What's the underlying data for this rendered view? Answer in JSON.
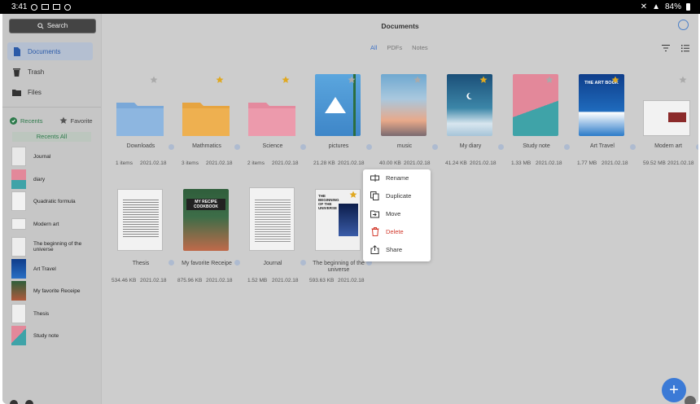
{
  "status": {
    "time": "3:41",
    "battery": "84%"
  },
  "sidebar": {
    "search_label": "Search",
    "nav": [
      {
        "label": "Documents"
      },
      {
        "label": "Trash"
      },
      {
        "label": "Files"
      }
    ],
    "recents_tab": "Recents",
    "favorite_tab": "Favorite",
    "recents_all": "Recents All",
    "recents": [
      {
        "label": "Journal"
      },
      {
        "label": "diary"
      },
      {
        "label": "Quadratic formula"
      },
      {
        "label": "Modern art"
      },
      {
        "label": "The beginning of the universe"
      },
      {
        "label": "Art Travel"
      },
      {
        "label": "My favorite Receipe"
      },
      {
        "label": "Thesis"
      },
      {
        "label": "Study note"
      }
    ]
  },
  "header": {
    "title": "Documents",
    "filters": [
      {
        "label": "All"
      },
      {
        "label": "PDFs"
      },
      {
        "label": "Notes"
      }
    ]
  },
  "grid": {
    "row1": [
      {
        "name": "Downloads",
        "size": "1 items",
        "date": "2021.02.18",
        "starred": false
      },
      {
        "name": "Mathmatics",
        "size": "3 items",
        "date": "2021.02.18",
        "starred": true
      },
      {
        "name": "Science",
        "size": "2 items",
        "date": "2021.02.18",
        "starred": true
      },
      {
        "name": "pictures",
        "size": "21.28 KB",
        "date": "2021.02.18",
        "starred": false
      },
      {
        "name": "music",
        "size": "40.00 KB",
        "date": "2021.02.18",
        "starred": false
      },
      {
        "name": "My diary",
        "size": "41.24 KB",
        "date": "2021.02.18",
        "starred": true
      },
      {
        "name": "Study note",
        "size": "1.33 MB",
        "date": "2021.02.18",
        "starred": false
      },
      {
        "name": "Art Travel",
        "size": "1.77 MB",
        "date": "2021.02.18",
        "starred": true
      },
      {
        "name": "Modern art",
        "size": "59.52 MB",
        "date": "2021.02.18",
        "starred": false
      }
    ],
    "row2": [
      {
        "name": "Thesis",
        "size": "534.46 KB",
        "date": "2021.02.18"
      },
      {
        "name": "My favorite Receipe",
        "size": "875.96 KB",
        "date": "2021.02.18"
      },
      {
        "name": "Journal",
        "size": "1.52 MB",
        "date": "2021.02.18"
      },
      {
        "name": "The beginning of the universe",
        "size": "593.63 KB",
        "date": "2021.02.18"
      }
    ],
    "cover_text": {
      "art_book": "THE ART BOOK",
      "recipe": "MY RECIPE COOKBOOK",
      "universe": "THE BEGINNING OF THE UNIVERSE"
    }
  },
  "context_menu": [
    {
      "label": "Rename",
      "icon": "rename-icon"
    },
    {
      "label": "Duplicate",
      "icon": "duplicate-icon"
    },
    {
      "label": "Move",
      "icon": "move-icon"
    },
    {
      "label": "Delete",
      "icon": "trash-icon"
    },
    {
      "label": "Share",
      "icon": "share-icon"
    }
  ],
  "colors": {
    "accent": "#3f72c6",
    "danger": "#d33b2e",
    "folder_blue": "#7aa8d8",
    "folder_orange": "#e6a440",
    "folder_pink": "#e48a9e",
    "star": "#e0a820"
  }
}
